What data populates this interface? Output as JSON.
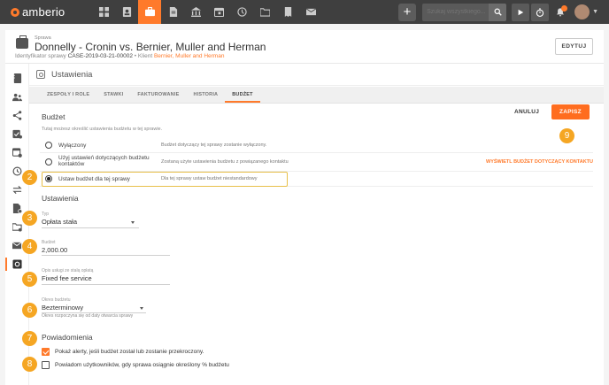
{
  "topbar": {
    "logo_text": "amberio",
    "nav_icons": [
      "dashboard-icon",
      "contacts-icon",
      "cases-icon",
      "documents-icon",
      "court-icon",
      "calendar-icon",
      "time-icon",
      "folder-icon",
      "invoices-icon",
      "mail-icon"
    ],
    "active_nav": "cases-icon",
    "search_placeholder": "Szukaj wszystkiego...",
    "accent": "#ff7a2b"
  },
  "header": {
    "crumb": "Sprawa",
    "title": "Donnelly - Cronin vs. Bernier, Muller and Herman",
    "id_label": "Identyfikator sprawy",
    "id_value": "CASE-2019-03-21-00002",
    "separator": "•",
    "client_label": "Klient",
    "client_value": "Bernier, Muller and Herman",
    "edit_button": "EDYTUJ"
  },
  "sidebar": {
    "icons": [
      "notebook-icon",
      "people-icon",
      "share-icon",
      "task-check-icon",
      "calendar-clock-icon",
      "time-history-icon",
      "transfer-icon",
      "invoice-icon",
      "folder-settings-icon",
      "mail-icon",
      "settings-icon"
    ],
    "active": "settings-icon"
  },
  "settings": {
    "title": "Ustawienia",
    "tabs": [
      "ZESPOŁY I ROLE",
      "STAWKI",
      "FAKTUROWANIE",
      "HISTORIA",
      "BUDŻET"
    ],
    "active_tab": "BUDŻET"
  },
  "budget": {
    "title": "Budżet",
    "help": "Tutaj możesz określić ustawienia budżetu w tej sprawie.",
    "cancel": "ANULUJ",
    "save": "ZAPISZ",
    "options": [
      {
        "label": "Wyłączony",
        "desc": "Budżet dotyczący tej sprawy zostanie wyłączony.",
        "link": "",
        "selected": false
      },
      {
        "label": "Użyj ustawień dotyczących budżetu kontaktów",
        "desc": "Zostaną użyte ustawienia budżetu z powiązanego kontaktu",
        "link": "WYŚWIETL BUDŻET DOTYCZĄCY KONTAKTU",
        "selected": false
      },
      {
        "label": "Ustaw budżet dla tej sprawy",
        "desc": "Dla tej sprawy ustaw budżet niestandardowy",
        "link": "",
        "selected": true
      }
    ]
  },
  "ustawienia": {
    "title": "Ustawienia",
    "type_label": "Typ",
    "type_value": "Opłata stała",
    "budget_label": "Budżet",
    "budget_value": "2,000.00",
    "desc_label": "Opis usługi ze stałą opłatą",
    "desc_value": "Fixed fee service",
    "period_label": "Okres budżetu",
    "period_value": "Bezterminowy",
    "period_help": "Okres rozpoczyna się od daty otwarcia sprawy"
  },
  "notifications": {
    "title": "Powiadomienia",
    "items": [
      {
        "label": "Pokaż alerty, jeśli budżet został lub zostanie przekroczony.",
        "checked": true
      },
      {
        "label": "Powiadom użytkowników, gdy sprawa osiągnie określony % budżetu",
        "checked": false
      }
    ]
  },
  "badges": [
    "2",
    "3",
    "4",
    "5",
    "6",
    "7",
    "8",
    "9"
  ]
}
